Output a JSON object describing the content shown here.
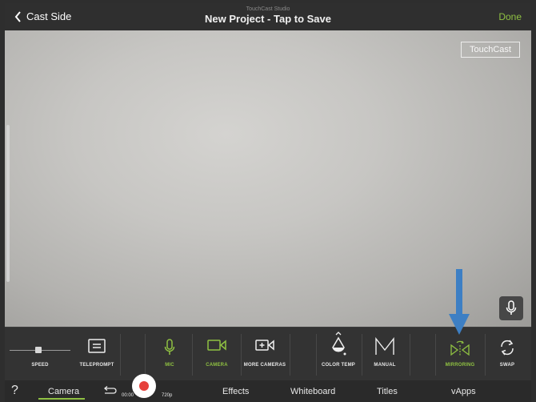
{
  "header": {
    "back_label": "Cast Side",
    "studio_label": "TouchCast Studio",
    "project_title": "New Project - Tap to Save",
    "done_label": "Done"
  },
  "preview": {
    "watermark": "TouchCast"
  },
  "toolbar": {
    "speed": "SPEED",
    "teleprompt": "TELEPROMPT",
    "mic": "MIC",
    "camera": "CAMERA",
    "more_cameras": "MORE CAMERAS",
    "color_temp": "COLOR TEMP",
    "manual": "MANUAL",
    "mirroring": "MIRRORING",
    "swap": "SWAP"
  },
  "tabbar": {
    "help": "?",
    "camera": "Camera",
    "timer": "00:00",
    "resolution": "720p",
    "effects": "Effects",
    "whiteboard": "Whiteboard",
    "titles": "Titles",
    "vapps": "vApps"
  },
  "colors": {
    "accent": "#8fc142",
    "record": "#e6403b",
    "annotation_arrow": "#3d7fc4"
  }
}
